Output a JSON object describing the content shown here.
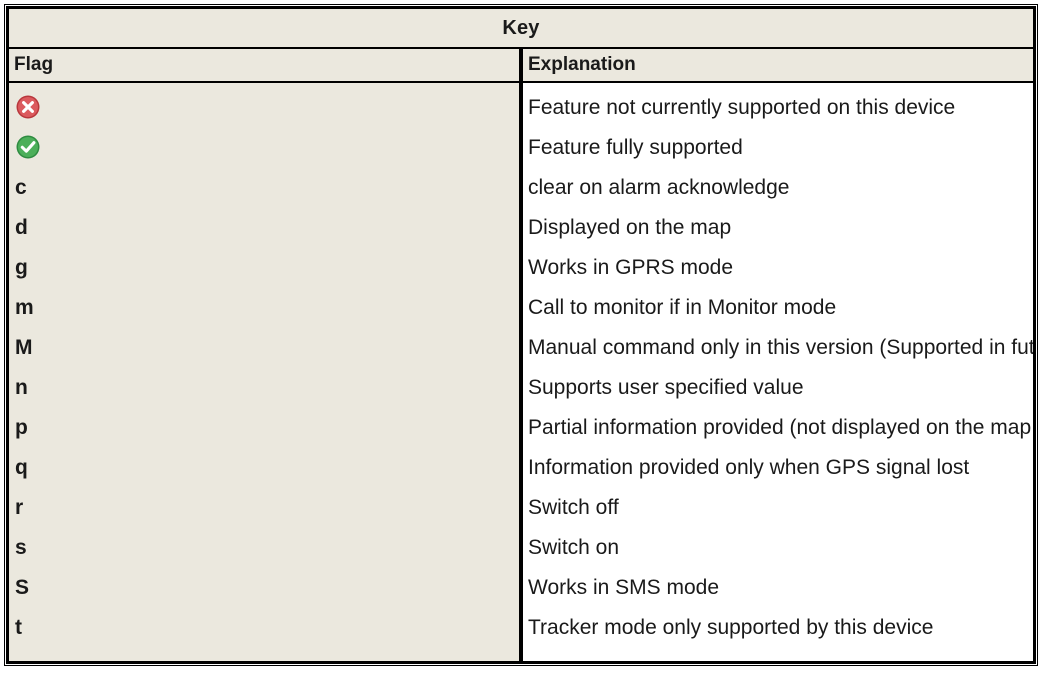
{
  "table": {
    "title": "Key",
    "columns": [
      {
        "key": "flag",
        "label": "Flag"
      },
      {
        "key": "explanation",
        "label": "Explanation"
      }
    ],
    "rows": [
      {
        "flag": "",
        "flag_icon": "red-cross-circle-icon",
        "explanation": "Feature not currently supported on this device"
      },
      {
        "flag": "",
        "flag_icon": "green-check-circle-icon",
        "explanation": "Feature fully supported"
      },
      {
        "flag": "c",
        "flag_icon": "",
        "explanation": "clear on alarm acknowledge"
      },
      {
        "flag": "d",
        "flag_icon": "",
        "explanation": "Displayed on the map"
      },
      {
        "flag": "g",
        "flag_icon": "",
        "explanation": "Works in GPRS mode"
      },
      {
        "flag": "m",
        "flag_icon": "",
        "explanation": "Call to monitor if in Monitor mode"
      },
      {
        "flag": "M",
        "flag_icon": "",
        "explanation": "Manual command only in this version (Supported in future version)"
      },
      {
        "flag": "n",
        "flag_icon": "",
        "explanation": "Supports user specified value"
      },
      {
        "flag": "p",
        "flag_icon": "",
        "explanation": "Partial information provided (not displayed on the map in this version)"
      },
      {
        "flag": "q",
        "flag_icon": "",
        "explanation": "Information provided only when GPS signal lost"
      },
      {
        "flag": "r",
        "flag_icon": "",
        "explanation": "Switch off"
      },
      {
        "flag": "s",
        "flag_icon": "",
        "explanation": "Switch on"
      },
      {
        "flag": "S",
        "flag_icon": "",
        "explanation": "Works in SMS mode"
      },
      {
        "flag": "t",
        "flag_icon": "",
        "explanation": "Tracker mode only supported by this device"
      }
    ]
  },
  "colors": {
    "header_background": "#EBE8DE",
    "body_background": "#FFFFFF",
    "border": "#000000",
    "text": "#1A1A1A",
    "not_supported_red": "#DB5A5E",
    "not_supported_red_dark": "#B8373C",
    "supported_green": "#4CAF5A",
    "supported_green_dark": "#2E8B40",
    "glyph_white": "#FFFFFF"
  }
}
